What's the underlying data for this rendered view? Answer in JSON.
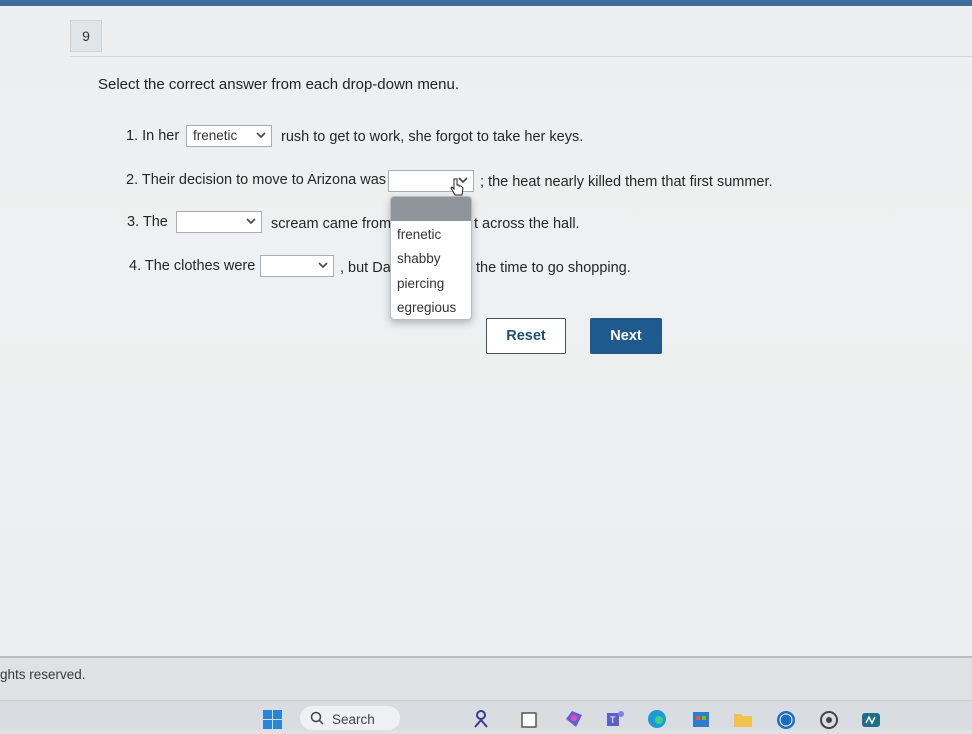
{
  "question": {
    "number": "9",
    "instruction": "Select the correct answer from each drop-down menu."
  },
  "items": [
    {
      "before": "1. In her",
      "selected": "frenetic",
      "after": "rush to get to work, she forgot to take her keys."
    },
    {
      "before": "2. Their decision to move to Arizona was",
      "selected": "",
      "after": "; the heat nearly killed them that first summer."
    },
    {
      "before": "3. The",
      "selected": "",
      "after": "scream came from",
      "after_tail": "t across the hall."
    },
    {
      "before": "4. The clothes were",
      "selected": "",
      "after": ", but Da",
      "after_tail": "the time to go shopping."
    }
  ],
  "dropdown_open": {
    "options": [
      "frenetic",
      "shabby",
      "piercing",
      "egregious"
    ]
  },
  "buttons": {
    "reset": "Reset",
    "next": "Next"
  },
  "footer": {
    "rights": "ghts reserved."
  },
  "taskbar": {
    "search_label": "Search",
    "icons": [
      "windows-start-icon",
      "search-icon",
      "people-icon",
      "file-explorer-icon",
      "copilot-icon",
      "teams-icon",
      "edge-icon",
      "store-icon",
      "folder-icon",
      "dell-icon",
      "chrome-icon",
      "app-icon"
    ]
  },
  "colors": {
    "accent": "#1f5a8e",
    "topbar": "#3d6f9e"
  }
}
